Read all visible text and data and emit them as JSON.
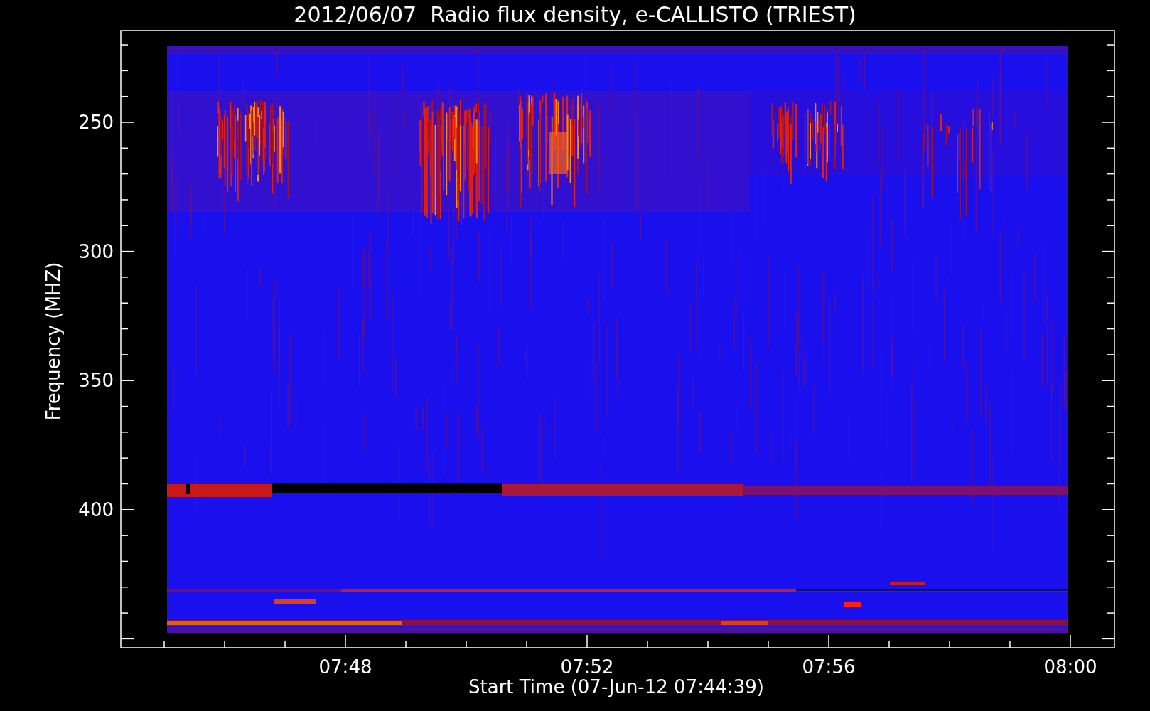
{
  "title": "2012/06/07  Radio flux density, e-CALLISTO (TRIEST)",
  "plot": {
    "ylabel": "Frequency (MHZ)",
    "xlabel": "Start Time (07-Jun-12 07:44:39)",
    "yticks": [
      "250",
      "300",
      "350",
      "400"
    ],
    "xticks": [
      "07:48",
      "07:52",
      "07:56",
      "08:00"
    ]
  }
}
